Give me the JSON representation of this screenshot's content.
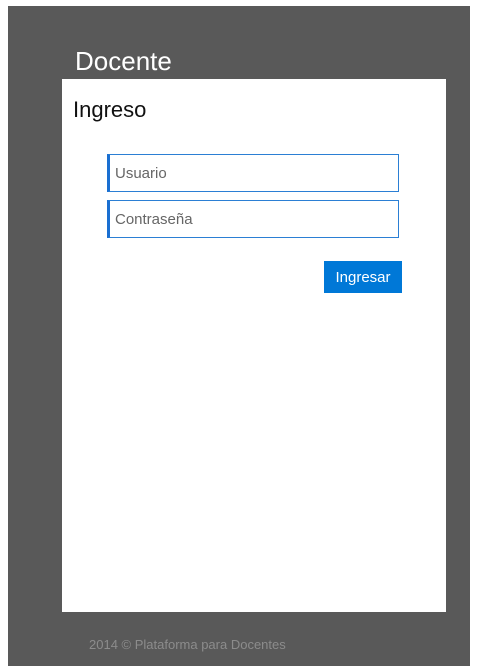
{
  "header": {
    "title": "Docente"
  },
  "login": {
    "heading": "Ingreso",
    "username_placeholder": "Usuario",
    "username_value": "",
    "password_placeholder": "Contraseña",
    "password_value": "",
    "submit_label": "Ingresar"
  },
  "footer": {
    "text": "2014 © Plataforma para Docentes"
  },
  "colors": {
    "frame_background": "#595959",
    "panel_background": "#ffffff",
    "accent": "#0078d7",
    "field_border": "#2b7fd4",
    "footer_text": "#8c8c8c"
  }
}
